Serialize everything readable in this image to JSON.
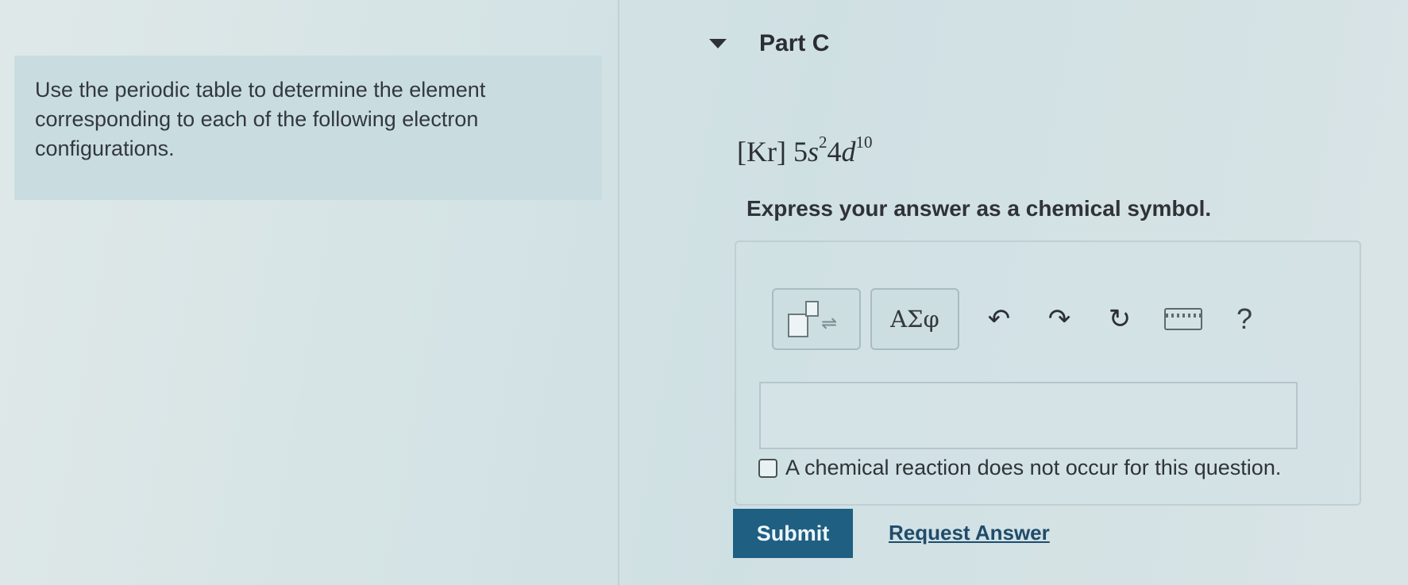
{
  "instruction": "Use the periodic table to determine the element corresponding to each of the following electron configurations.",
  "part": {
    "title": "Part C"
  },
  "formula": {
    "core": "[Kr]",
    "n1": "5",
    "o1": "s",
    "e1": "2",
    "n2": "4",
    "o2": "d",
    "e2": "10"
  },
  "prompt": "Express your answer as a chemical symbol.",
  "toolbar": {
    "greek_label": "ΑΣφ",
    "undo_glyph": "↶",
    "redo_glyph": "↷",
    "reset_glyph": "↻",
    "help_label": "?",
    "icons": [
      "templates-icon",
      "greek-icon",
      "undo-icon",
      "redo-icon",
      "reset-icon",
      "keyboard-icon",
      "help-icon"
    ]
  },
  "answer": {
    "value": ""
  },
  "no_reaction_label": "A chemical reaction does not occur for this question.",
  "submit_label": "Submit",
  "request_label": "Request Answer",
  "colors": {
    "submit_bg": "#1e5f82",
    "link": "#1f4c6b"
  }
}
